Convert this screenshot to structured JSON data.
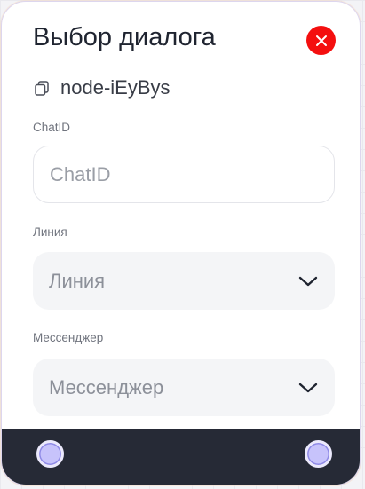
{
  "node": {
    "title": "Выбор диалога",
    "id_text": "node-iEyBys",
    "icons": {
      "close": "close-icon",
      "copy": "copy-icon",
      "chevron": "chevron-down-icon"
    }
  },
  "fields": {
    "chat_id": {
      "label": "ChatID",
      "placeholder": "ChatID",
      "value": ""
    },
    "line": {
      "label": "Линия",
      "selected": "Линия"
    },
    "messenger": {
      "label": "Мессенджер",
      "selected": "Мессенджер"
    }
  },
  "colors": {
    "close_button": "#f40f0f",
    "footer": "#262a36",
    "handle": "#c7c3fb"
  }
}
